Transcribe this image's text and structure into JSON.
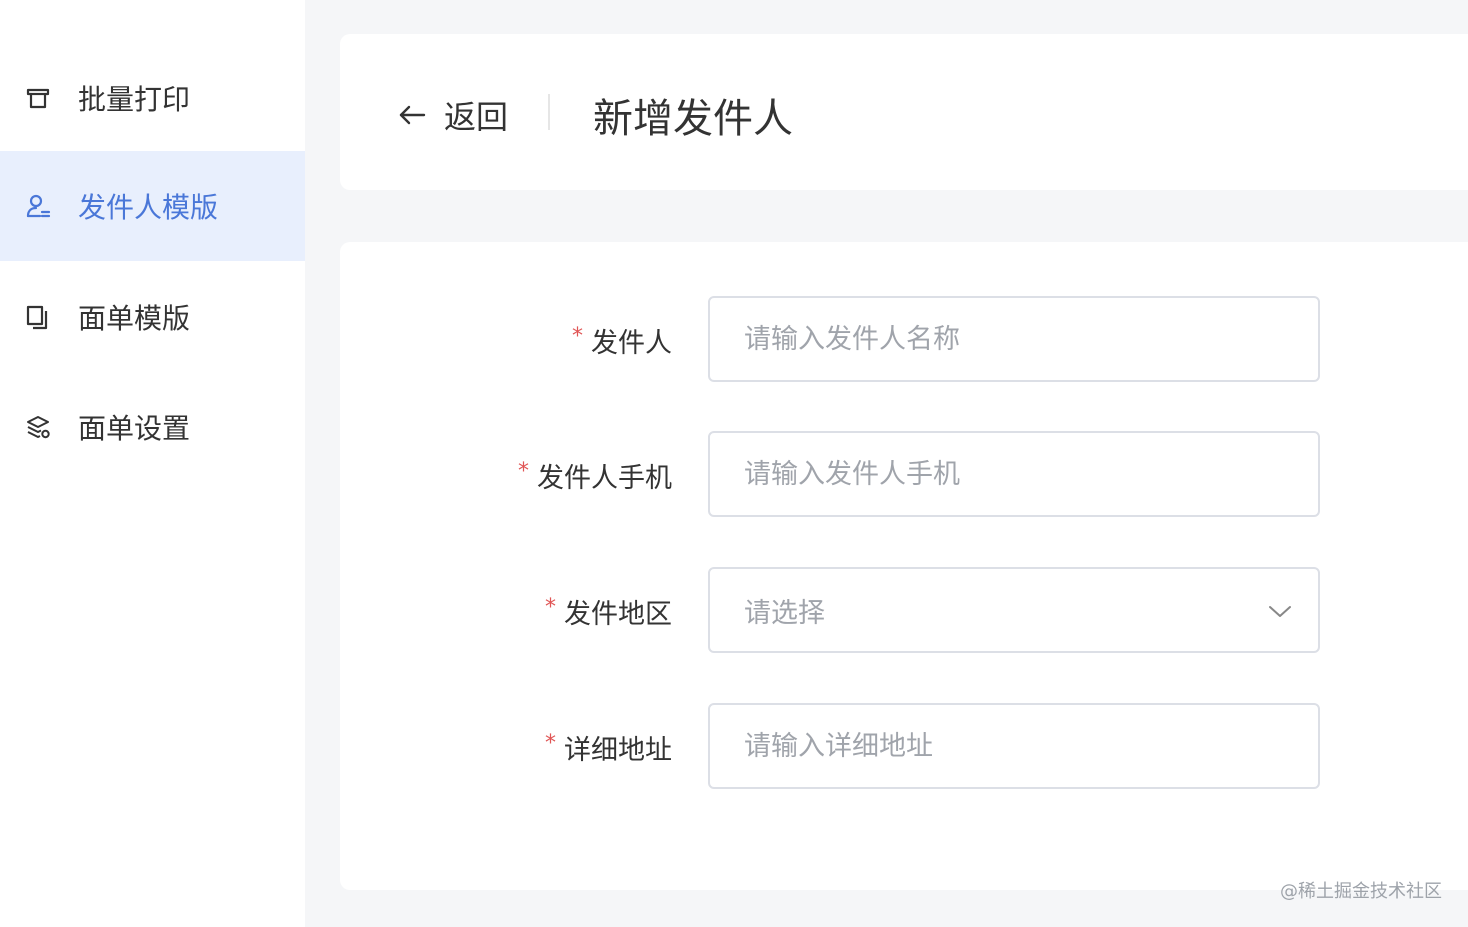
{
  "sidebar": {
    "items": [
      {
        "label": "批量打印",
        "icon": "printer-icon",
        "active": false
      },
      {
        "label": "发件人模版",
        "icon": "user-icon",
        "active": true
      },
      {
        "label": "面单模版",
        "icon": "copy-icon",
        "active": false
      },
      {
        "label": "面单设置",
        "icon": "layers-settings-icon",
        "active": false
      }
    ]
  },
  "header": {
    "back_label": "返回",
    "title": "新增发件人"
  },
  "form": {
    "fields": [
      {
        "label": "发件人",
        "required_mark": "*",
        "placeholder": "请输入发件人名称",
        "type": "input"
      },
      {
        "label": "发件人手机",
        "required_mark": "*",
        "placeholder": "请输入发件人手机",
        "type": "input"
      },
      {
        "label": "发件地区",
        "required_mark": "*",
        "placeholder": "请选择",
        "type": "select"
      },
      {
        "label": "详细地址",
        "required_mark": "*",
        "placeholder": "请输入详细地址",
        "type": "input"
      }
    ]
  },
  "watermark": "@稀土掘金技术社区",
  "colors": {
    "accent": "#4a77d8",
    "active_bg": "#e8effd",
    "required": "#e05555",
    "page_bg": "#f5f6f8"
  }
}
